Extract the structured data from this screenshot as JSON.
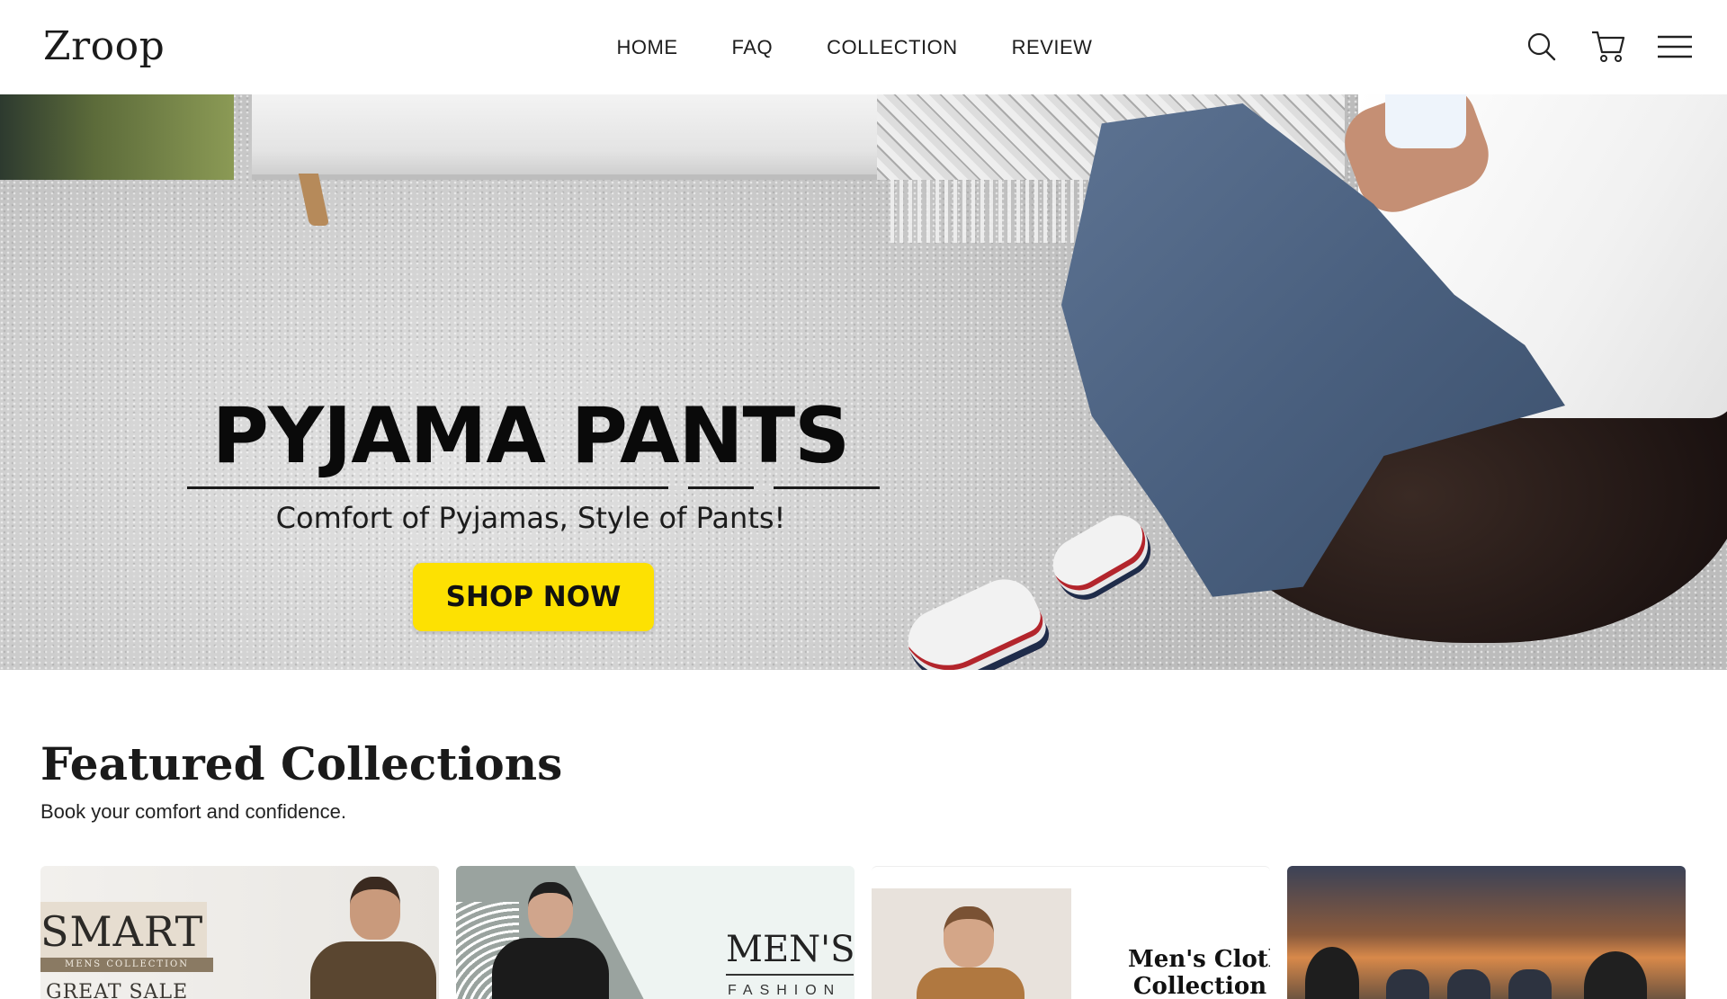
{
  "header": {
    "logo": "Zroop",
    "nav": [
      "HOME",
      "FAQ",
      "COLLECTION",
      "REVIEW"
    ],
    "icons": [
      "search-icon",
      "cart-icon",
      "menu-icon"
    ]
  },
  "hero": {
    "title": "PYJAMA PANTS",
    "subtitle": "Comfort of Pyjamas, Style of Pants!",
    "cta": "SHOP NOW",
    "cta_color": "#fde102"
  },
  "featured": {
    "title": "Featured Collections",
    "subtitle": "Book your comfort and confidence.",
    "cards": [
      {
        "line1": "SMART",
        "line2": "MENS COLLECTION",
        "line3": "GREAT SALE"
      },
      {
        "line1": "MEN'S",
        "line2": "FASHION"
      },
      {
        "line1": "Men's Clothing",
        "line2": "Collection"
      },
      {
        "line1": ""
      }
    ]
  }
}
